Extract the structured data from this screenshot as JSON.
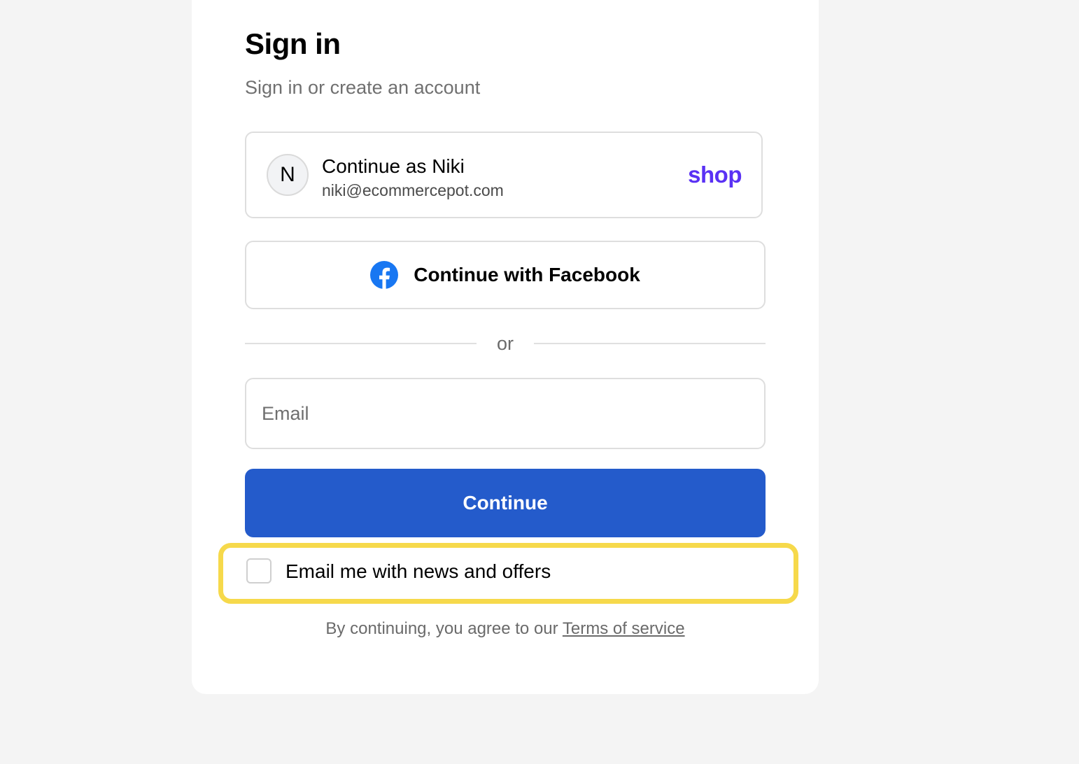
{
  "header": {
    "title": "Sign in",
    "subtitle": "Sign in or create an account"
  },
  "shop_account": {
    "avatar_initial": "N",
    "name_label": "Continue as Niki",
    "email": "niki@ecommercepot.com",
    "brand_logo": "shop",
    "brand_color": "#5a31f4"
  },
  "facebook": {
    "label": "Continue with Facebook",
    "icon": "facebook-icon",
    "brand_color": "#1877f2"
  },
  "divider": {
    "label": "or"
  },
  "email_field": {
    "placeholder": "Email",
    "value": ""
  },
  "continue_button": {
    "label": "Continue",
    "color": "#245bcb"
  },
  "newsletter": {
    "label": "Email me with news and offers",
    "checked": false,
    "highlight_color": "#f6d94b"
  },
  "terms": {
    "prefix": "By continuing, you agree to our ",
    "link_label": "Terms of service"
  }
}
